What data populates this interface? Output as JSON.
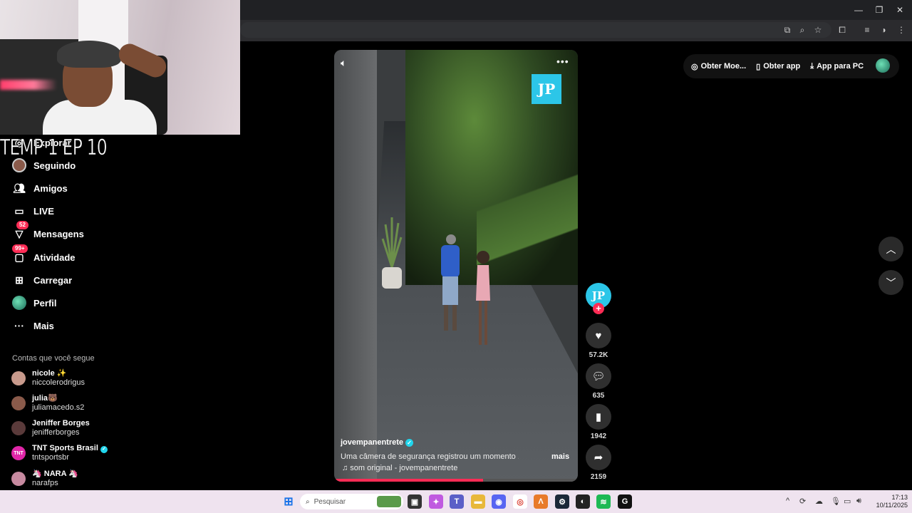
{
  "webcam_overlay": {
    "title": "TEMP 1 EP 10"
  },
  "sidebar": {
    "items": [
      {
        "label": "Explorar",
        "icon": "compass-icon"
      },
      {
        "label": "Seguindo",
        "icon": "following-avatar-icon"
      },
      {
        "label": "Amigos",
        "icon": "friends-icon"
      },
      {
        "label": "LIVE",
        "icon": "live-tv-icon"
      },
      {
        "label": "Mensagens",
        "icon": "messages-icon",
        "badge": "52"
      },
      {
        "label": "Atividade",
        "icon": "activity-icon",
        "badge": "99+"
      },
      {
        "label": "Carregar",
        "icon": "upload-plus-icon"
      },
      {
        "label": "Perfil",
        "icon": "profile-avatar-icon"
      },
      {
        "label": "Mais",
        "icon": "more-dots-icon"
      }
    ],
    "following_title": "Contas que você segue",
    "accounts": [
      {
        "name": "nicole ✨",
        "handle": "niccolerodrigus",
        "color": "#c89a8c"
      },
      {
        "name": "julia🐻",
        "handle": "juliamacedo.s2",
        "color": "#8a5a4a"
      },
      {
        "name": "Jeniffer Borges",
        "handle": "jenifferborges",
        "color": "#5a3a3a"
      },
      {
        "name": "TNT Sports Brasil",
        "handle": "tntsportsbr",
        "color": "#e026a8",
        "verified": true,
        "avatar_text": "TNT"
      },
      {
        "name": "🦄 NARA 🦄",
        "handle": "narafps",
        "color": "#c78aa0"
      }
    ]
  },
  "video": {
    "logo_text": "JP",
    "author": "jovempanentrete",
    "description": "Uma câmera de segurança registrou um momento ...",
    "more_label": "mais",
    "music": "♫ som original - jovempanentrete",
    "progress": 0.61
  },
  "actions": {
    "creator_logo": "JP",
    "likes": "57.2K",
    "comments": "635",
    "saves": "1942",
    "shares": "2159"
  },
  "top_bar": {
    "items": [
      {
        "label": "Obter Moe...",
        "icon": "coin-icon"
      },
      {
        "label": "Obter app",
        "icon": "phone-icon"
      },
      {
        "label": "App para PC",
        "icon": "download-icon"
      }
    ]
  },
  "taskbar": {
    "search_placeholder": "Pesquisar",
    "time": "17:13",
    "date": "10/11/2025"
  },
  "colors": {
    "accent": "#fe2c55",
    "brand_cyan": "#2cc6e8"
  }
}
